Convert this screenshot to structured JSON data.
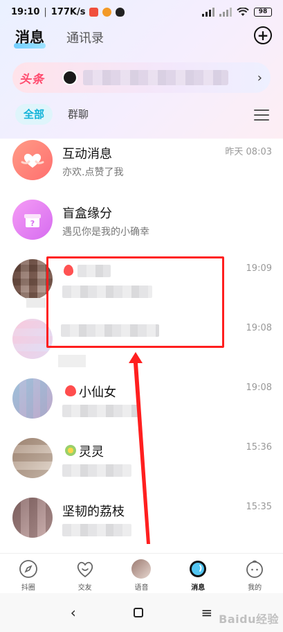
{
  "status_bar": {
    "time": "19:10",
    "speed": "177K/s",
    "battery": "98"
  },
  "header": {
    "tab_messages": "消息",
    "tab_contacts": "通讯录"
  },
  "headline": {
    "label": "头条"
  },
  "filters": {
    "all": "全部",
    "group_chat": "群聊"
  },
  "conversations": [
    {
      "name": "互动消息",
      "preview": "亦欢.点赞了我",
      "time": "昨天 08:03"
    },
    {
      "name": "盲盒缘分",
      "preview": "遇见你是我的小确幸",
      "time": ""
    },
    {
      "name": "",
      "preview": "",
      "time": "19:09"
    },
    {
      "name": "",
      "preview": "",
      "time": "19:08"
    },
    {
      "name": "小仙女",
      "preview": "",
      "time": "19:08"
    },
    {
      "name": "灵灵",
      "preview": "",
      "time": "15:36"
    },
    {
      "name": "坚韧的荔枝",
      "preview": "",
      "time": "15:35"
    }
  ],
  "tabbar": [
    {
      "label": "抖圈",
      "icon": "compass-icon"
    },
    {
      "label": "交友",
      "icon": "heart-face-icon"
    },
    {
      "label": "语音",
      "icon": "voice-avatar-icon"
    },
    {
      "label": "消息",
      "icon": "message-bubble-icon"
    },
    {
      "label": "我的",
      "icon": "profile-face-icon"
    }
  ],
  "colors": {
    "accent": "#12b3d9",
    "headline_red": "#ff4b6e",
    "annotation_red": "#ff1f1f"
  }
}
